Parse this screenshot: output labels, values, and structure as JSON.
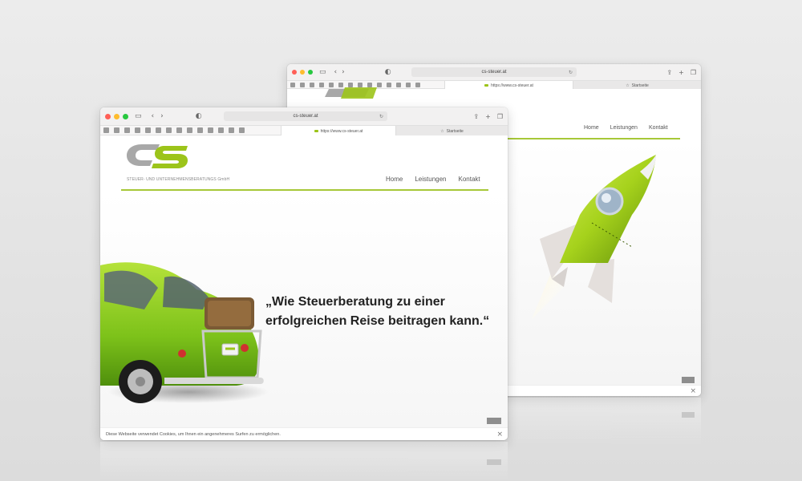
{
  "colors": {
    "brand_green": "#9cc41a",
    "logo_gray": "#a8a8a8",
    "mac_red": "#ff5f57",
    "mac_yellow": "#febc2e",
    "mac_green": "#28c840"
  },
  "back_window": {
    "address": "cs-steuer.at",
    "tabs": [
      {
        "label": "https://www.cs-steuer.at",
        "active": true
      },
      {
        "label": "Startseite",
        "active": false
      }
    ],
    "nav": [
      "Home",
      "Leistungen",
      "Kontakt"
    ],
    "hero_image": "rocket"
  },
  "front_window": {
    "address": "cs-steuer.at",
    "tabs": [
      {
        "label": "https://www.cs-steuer.at",
        "active": true
      },
      {
        "label": "Startseite",
        "active": false
      }
    ],
    "logo_text": "CS",
    "logo_subtitle": "STEUER- UND UNTERNEHMENSBERATUNGS GmbH",
    "nav": [
      "Home",
      "Leistungen",
      "Kontakt"
    ],
    "hero_quote_line1": "„Wie Steuerberatung zu einer",
    "hero_quote_line2": "erfolgreichen Reise beitragen kann.“",
    "hero_image": "green-beetle-car",
    "cookie_text": "Diese Webseite verwendet Cookies, um Ihnen ein angenehmeres Surfen zu ermöglichen.",
    "cookie_close": "×"
  },
  "icons": {
    "sidebar": "sidebar-icon",
    "back": "chevron-left-icon",
    "forward": "chevron-right-icon",
    "shield": "shield-icon",
    "share": "share-icon",
    "new_tab": "plus-icon",
    "tabs_overview": "tabs-icon",
    "star": "star-icon"
  }
}
